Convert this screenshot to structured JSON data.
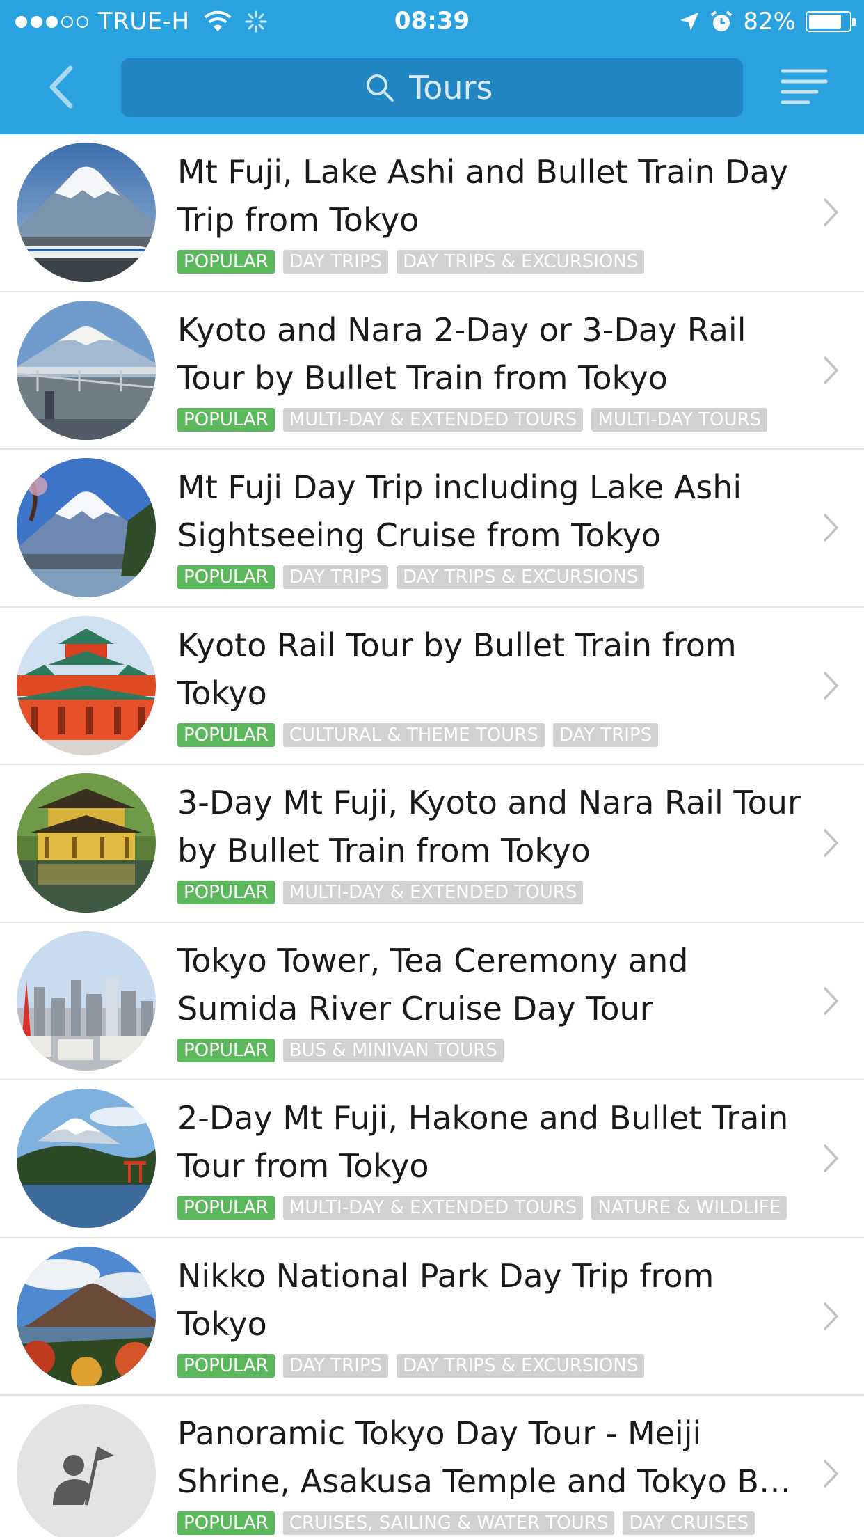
{
  "status_bar": {
    "carrier": "TRUE-H",
    "time": "08:39",
    "battery": "82%",
    "battery_level": 0.82
  },
  "nav": {
    "search_placeholder": "Tours"
  },
  "tours": [
    {
      "title": "Mt Fuji, Lake Ashi and Bullet Train Day Trip from Tokyo",
      "tags": [
        "POPULAR",
        "DAY TRIPS",
        "DAY TRIPS & EXCURSIONS"
      ]
    },
    {
      "title": "Kyoto and Nara 2-Day or 3-Day Rail Tour by Bullet Train from Tokyo",
      "tags": [
        "POPULAR",
        "MULTI-DAY & EXTENDED TOURS",
        "MULTI-DAY TOURS"
      ]
    },
    {
      "title": "Mt Fuji Day Trip including Lake Ashi Sightseeing Cruise from Tokyo",
      "tags": [
        "POPULAR",
        "DAY TRIPS",
        "DAY TRIPS & EXCURSIONS"
      ]
    },
    {
      "title": "Kyoto Rail Tour by Bullet Train from Tokyo",
      "tags": [
        "POPULAR",
        "CULTURAL & THEME TOURS",
        "DAY TRIPS"
      ]
    },
    {
      "title": "3-Day Mt Fuji, Kyoto and Nara Rail Tour by Bullet Train from Tokyo",
      "tags": [
        "POPULAR",
        "MULTI-DAY & EXTENDED TOURS"
      ]
    },
    {
      "title": "Tokyo Tower, Tea Ceremony and Sumida River Cruise Day Tour",
      "tags": [
        "POPULAR",
        "BUS & MINIVAN TOURS"
      ]
    },
    {
      "title": "2-Day Mt Fuji, Hakone and Bullet Train Tour from Tokyo",
      "tags": [
        "POPULAR",
        "MULTI-DAY & EXTENDED TOURS",
        "NATURE & WILDLIFE"
      ]
    },
    {
      "title": "Nikko National Park Day Trip from Tokyo",
      "tags": [
        "POPULAR",
        "DAY TRIPS",
        "DAY TRIPS & EXCURSIONS"
      ]
    },
    {
      "title": "Panoramic Tokyo Day Tour - Meiji Shrine, Asakusa Temple and Tokyo B…",
      "tags": [
        "POPULAR",
        "CRUISES, SAILING & WATER TOURS",
        "DAY CRUISES"
      ]
    }
  ]
}
